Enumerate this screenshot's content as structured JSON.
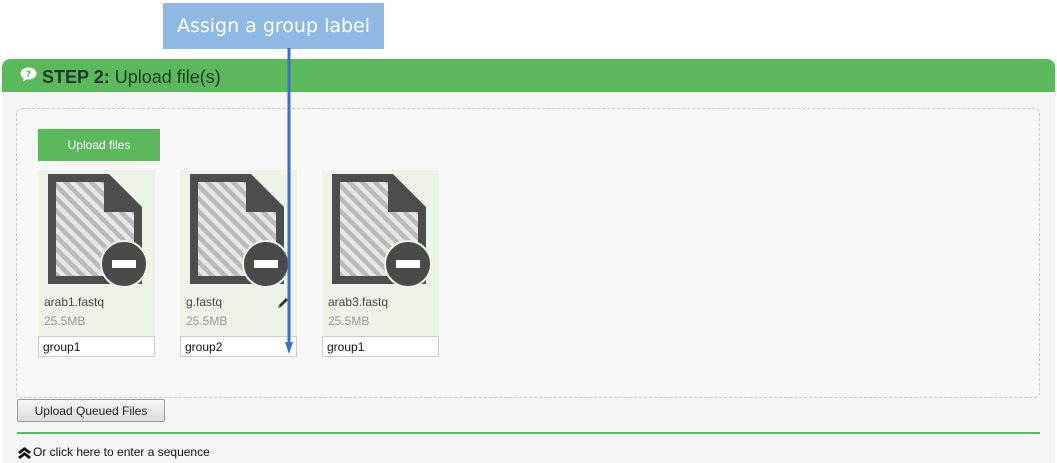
{
  "callout": {
    "text": "Assign a group label"
  },
  "step": {
    "prefix": "STEP 2:",
    "title": "Upload file(s)"
  },
  "toolbar": {
    "upload_label": "Upload files"
  },
  "files": [
    {
      "name": "arab1.fastq",
      "size": "25.5MB",
      "group": "group1"
    },
    {
      "name": "g.fastq",
      "size": "25.5MB",
      "group": "group2"
    },
    {
      "name": "arab3.fastq",
      "size": "25.5MB",
      "group": "group1"
    }
  ],
  "actions": {
    "upload_queued_label": "Upload Queued Files"
  },
  "sequence_link": {
    "text": "Or click here to enter a sequence"
  },
  "colors": {
    "accent": "#5cb85c",
    "callout": "#8fb9e3",
    "arrow": "#3a73b8"
  },
  "icons": [
    "chat-icon",
    "file-icon",
    "remove-icon",
    "pencil-icon",
    "double-chevron-up-icon"
  ]
}
